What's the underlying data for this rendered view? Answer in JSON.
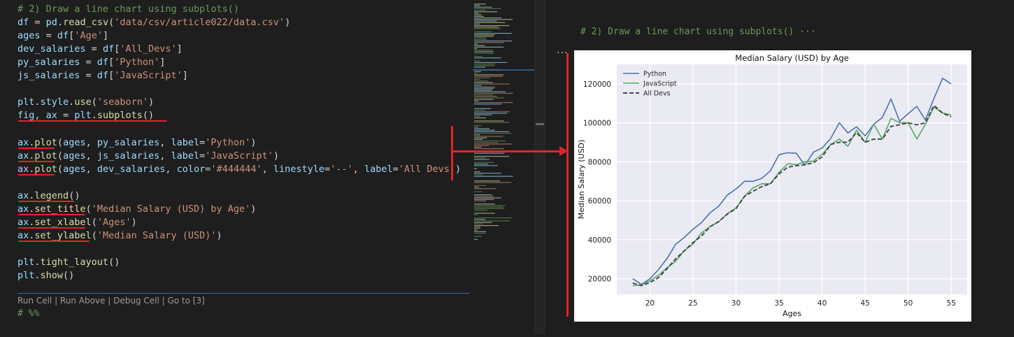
{
  "editor": {
    "lines": [
      [
        [
          "t-com",
          "# 2) Draw a line chart using subplots()"
        ]
      ],
      [
        [
          "t-var",
          "df"
        ],
        [
          "t-op",
          " = "
        ],
        [
          "t-var",
          "pd"
        ],
        [
          "t-op",
          "."
        ],
        [
          "t-fn",
          "read_csv"
        ],
        [
          "t-op",
          "("
        ],
        [
          "t-str",
          "'data/csv/article022/data.csv'"
        ],
        [
          "t-op",
          ")"
        ]
      ],
      [
        [
          "t-var",
          "ages"
        ],
        [
          "t-op",
          " = "
        ],
        [
          "t-var",
          "df"
        ],
        [
          "t-op",
          "["
        ],
        [
          "t-str",
          "'Age'"
        ],
        [
          "t-op",
          "]"
        ]
      ],
      [
        [
          "t-var",
          "dev_salaries"
        ],
        [
          "t-op",
          " = "
        ],
        [
          "t-var",
          "df"
        ],
        [
          "t-op",
          "["
        ],
        [
          "t-str",
          "'All_Devs'"
        ],
        [
          "t-op",
          "]"
        ]
      ],
      [
        [
          "t-var",
          "py_salaries"
        ],
        [
          "t-op",
          " = "
        ],
        [
          "t-var",
          "df"
        ],
        [
          "t-op",
          "["
        ],
        [
          "t-str",
          "'Python'"
        ],
        [
          "t-op",
          "]"
        ]
      ],
      [
        [
          "t-var",
          "js_salaries"
        ],
        [
          "t-op",
          " = "
        ],
        [
          "t-var",
          "df"
        ],
        [
          "t-op",
          "["
        ],
        [
          "t-str",
          "'JavaScript'"
        ],
        [
          "t-op",
          "]"
        ]
      ],
      [],
      [
        [
          "t-var",
          "plt"
        ],
        [
          "t-op",
          "."
        ],
        [
          "t-var",
          "style"
        ],
        [
          "t-op",
          "."
        ],
        [
          "t-fn",
          "use"
        ],
        [
          "t-op",
          "("
        ],
        [
          "t-str",
          "'seaborn'"
        ],
        [
          "t-op",
          ")"
        ]
      ],
      [
        [
          "t-var",
          "fig"
        ],
        [
          "t-op",
          ", "
        ],
        [
          "t-var",
          "ax"
        ],
        [
          "t-op",
          " = "
        ],
        [
          "t-var",
          "plt"
        ],
        [
          "t-op",
          "."
        ],
        [
          "t-fn",
          "subplots"
        ],
        [
          "t-op",
          "()"
        ]
      ],
      [],
      [
        [
          "t-var",
          "ax"
        ],
        [
          "t-op",
          "."
        ],
        [
          "t-fn",
          "plot"
        ],
        [
          "t-op",
          "("
        ],
        [
          "t-var",
          "ages"
        ],
        [
          "t-op",
          ", "
        ],
        [
          "t-var",
          "py_salaries"
        ],
        [
          "t-op",
          ", "
        ],
        [
          "t-var",
          "label"
        ],
        [
          "t-op",
          "="
        ],
        [
          "t-str",
          "'Python'"
        ],
        [
          "t-op",
          ")"
        ]
      ],
      [
        [
          "t-var",
          "ax"
        ],
        [
          "t-op",
          "."
        ],
        [
          "t-fn",
          "plot"
        ],
        [
          "t-op",
          "("
        ],
        [
          "t-var",
          "ages"
        ],
        [
          "t-op",
          ", "
        ],
        [
          "t-var",
          "js_salaries"
        ],
        [
          "t-op",
          ", "
        ],
        [
          "t-var",
          "label"
        ],
        [
          "t-op",
          "="
        ],
        [
          "t-str",
          "'JavaScript'"
        ],
        [
          "t-op",
          ")"
        ]
      ],
      [
        [
          "t-var",
          "ax"
        ],
        [
          "t-op",
          "."
        ],
        [
          "t-fn",
          "plot"
        ],
        [
          "t-op",
          "("
        ],
        [
          "t-var",
          "ages"
        ],
        [
          "t-op",
          ", "
        ],
        [
          "t-var",
          "dev_salaries"
        ],
        [
          "t-op",
          ", "
        ],
        [
          "t-var",
          "color"
        ],
        [
          "t-op",
          "="
        ],
        [
          "t-str",
          "'#444444'"
        ],
        [
          "t-op",
          ", "
        ],
        [
          "t-var",
          "linestyle"
        ],
        [
          "t-op",
          "="
        ],
        [
          "t-str",
          "'--'"
        ],
        [
          "t-op",
          ", "
        ],
        [
          "t-var",
          "label"
        ],
        [
          "t-op",
          "="
        ],
        [
          "t-str",
          "'All Devs'"
        ],
        [
          "t-op",
          ")"
        ]
      ],
      [],
      [
        [
          "t-var",
          "ax"
        ],
        [
          "t-op",
          "."
        ],
        [
          "t-fn",
          "legend"
        ],
        [
          "t-op",
          "()"
        ]
      ],
      [
        [
          "t-var",
          "ax"
        ],
        [
          "t-op",
          "."
        ],
        [
          "t-fn",
          "set_title"
        ],
        [
          "t-op",
          "("
        ],
        [
          "t-str",
          "'Median Salary (USD) by Age'"
        ],
        [
          "t-op",
          ")"
        ]
      ],
      [
        [
          "t-var",
          "ax"
        ],
        [
          "t-op",
          "."
        ],
        [
          "t-fn",
          "set_xlabel"
        ],
        [
          "t-op",
          "("
        ],
        [
          "t-str",
          "'Ages'"
        ],
        [
          "t-op",
          ")"
        ]
      ],
      [
        [
          "t-var",
          "ax"
        ],
        [
          "t-op",
          "."
        ],
        [
          "t-fn",
          "set_ylabel"
        ],
        [
          "t-op",
          "("
        ],
        [
          "t-str",
          "'Median Salary (USD)'"
        ],
        [
          "t-op",
          ")"
        ]
      ],
      [],
      [
        [
          "t-var",
          "plt"
        ],
        [
          "t-op",
          "."
        ],
        [
          "t-fn",
          "tight_layout"
        ],
        [
          "t-op",
          "()"
        ]
      ],
      [
        [
          "t-var",
          "plt"
        ],
        [
          "t-op",
          "."
        ],
        [
          "t-fn",
          "show"
        ],
        [
          "t-op",
          "()"
        ]
      ]
    ],
    "codelens": "Run Cell | Run Above | Debug Cell | Go to [3]",
    "next_cell": "# %%"
  },
  "right_pane": {
    "cell_comment": "# 2) Draw a line chart using subplots() ···",
    "output_more": "···"
  },
  "colors": {
    "python": "#4c72b0",
    "javascript": "#55a868",
    "all_devs": "#444444",
    "plot_bg": "#eaeaf2",
    "annotation": "#e0242a"
  },
  "chart_data": {
    "type": "line",
    "title": "Median Salary (USD) by Age",
    "xlabel": "Ages",
    "ylabel": "Median Salary (USD)",
    "xlim": [
      16.15,
      56.85
    ],
    "ylim": [
      12000,
      130000
    ],
    "xticks": [
      20,
      25,
      30,
      35,
      40,
      45,
      50,
      55
    ],
    "yticks": [
      20000,
      40000,
      60000,
      80000,
      100000,
      120000
    ],
    "grid": true,
    "legend": "top-left",
    "x": [
      18,
      19,
      20,
      21,
      22,
      23,
      24,
      25,
      26,
      27,
      28,
      29,
      30,
      31,
      32,
      33,
      34,
      35,
      36,
      37,
      38,
      39,
      40,
      41,
      42,
      43,
      44,
      45,
      46,
      47,
      48,
      49,
      50,
      51,
      52,
      53,
      54,
      55
    ],
    "series": [
      {
        "name": "Python",
        "color": "#4c72b0",
        "dash": false,
        "values": [
          20046,
          17100,
          20000,
          24744,
          30500,
          37732,
          41247,
          45372,
          48876,
          53850,
          57287,
          63016,
          65998,
          70003,
          70000,
          71496,
          75370,
          83640,
          84666,
          84392,
          78254,
          85000,
          87038,
          91991,
          100000,
          94796,
          97962,
          93302,
          99240,
          102736,
          112285,
          100771,
          104708,
          108423,
          101407,
          112542,
          122870,
          120000
        ]
      },
      {
        "name": "JavaScript",
        "color": "#55a868",
        "dash": false,
        "values": [
          16446,
          16791,
          18942,
          21780,
          25704,
          29000,
          34372,
          37810,
          43515,
          46823,
          49293,
          53437,
          56373,
          62375,
          66674,
          68745,
          68746,
          74583,
          79000,
          78508,
          79996,
          80403,
          83820,
          88833,
          91660,
          87892,
          96243,
          90000,
          99313,
          91660,
          102264,
          100000,
          100000,
          91660,
          99240,
          108000,
          105000,
          104000
        ]
      },
      {
        "name": "All Devs",
        "color": "#444444",
        "dash": true,
        "values": [
          17784,
          16500,
          18012,
          20628,
          25206,
          30252,
          34368,
          38496,
          42000,
          46752,
          49320,
          53200,
          56000,
          62316,
          64928,
          67317,
          68748,
          73752,
          77232,
          78000,
          78508,
          79536,
          82488,
          88935,
          90000,
          90056,
          95000,
          90000,
          91633,
          91660,
          98150,
          98964,
          100000,
          98988,
          100000,
          108923,
          105000,
          103117
        ]
      }
    ]
  }
}
